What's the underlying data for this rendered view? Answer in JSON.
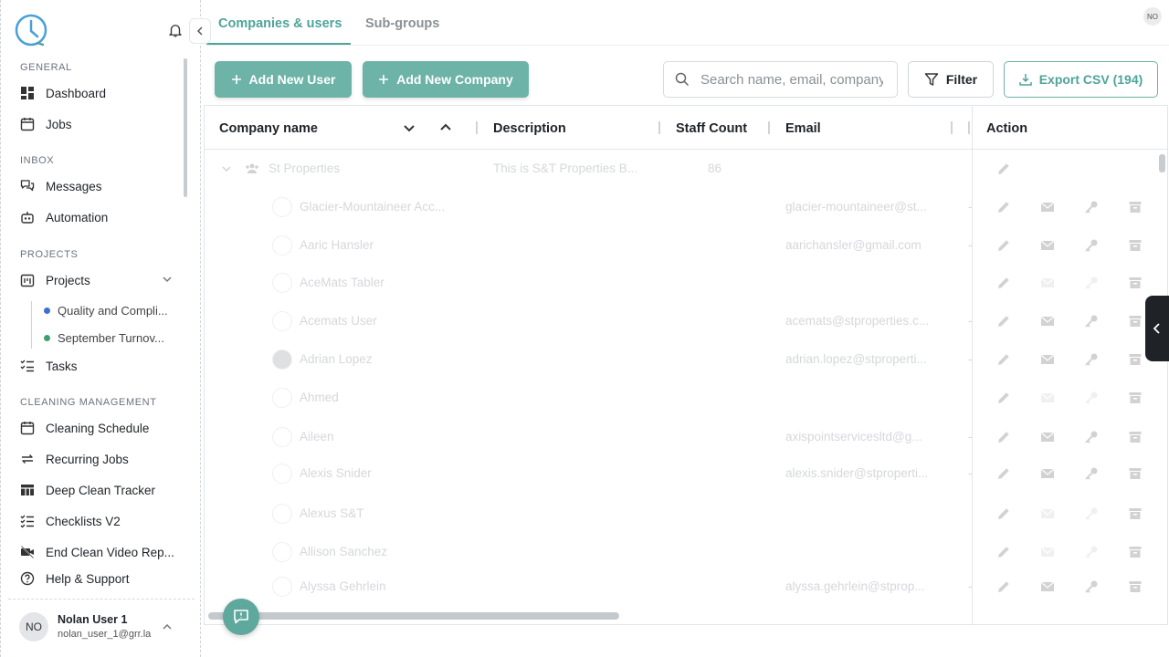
{
  "colors": {
    "accent": "#4ea49a",
    "button": "#6db3a8",
    "blue_dot": "#3b6fd4",
    "green_dot": "#3f9e6f"
  },
  "sidebar": {
    "sections": [
      {
        "label": "GENERAL"
      },
      {
        "label": "INBOX"
      },
      {
        "label": "PROJECTS"
      },
      {
        "label": "CLEANING MANAGEMENT"
      }
    ],
    "items": {
      "dashboard": "Dashboard",
      "jobs": "Jobs",
      "messages": "Messages",
      "automation": "Automation",
      "projects": "Projects",
      "quality": "Quality and Compli...",
      "september": "September Turnov...",
      "tasks": "Tasks",
      "cleaning_schedule": "Cleaning Schedule",
      "recurring_jobs": "Recurring Jobs",
      "deep_clean": "Deep Clean Tracker",
      "checklists": "Checklists V2",
      "end_clean": "End Clean Video Rep...",
      "help": "Help & Support"
    },
    "user": {
      "initials": "NO",
      "name": "Nolan User 1",
      "email": "nolan_user_1@grr.la"
    }
  },
  "tabs": [
    {
      "label": "Companies & users"
    },
    {
      "label": "Sub-groups"
    }
  ],
  "top_avatar": "NO",
  "toolbar": {
    "add_user": "Add New User",
    "add_company": "Add New Company",
    "search_placeholder": "Search name, email, company",
    "filter": "Filter",
    "export": "Export CSV (194)"
  },
  "table": {
    "columns": {
      "company": "Company name",
      "description": "Description",
      "staff": "Staff Count",
      "email": "Email",
      "action": "Action"
    },
    "group": {
      "name": "St Properties",
      "description": "This is S&T Properties B...",
      "staff": "86"
    },
    "rows": [
      {
        "name": "Glacier-Mountaineer Acc...",
        "email": "glacier-mountaineer@st..."
      },
      {
        "name": "Aaric Hansler",
        "email": "aarichansler@gmail.com"
      },
      {
        "name": "AceMats Tabler",
        "email": ""
      },
      {
        "name": "Acemats User",
        "email": "acemats@stproperties.c..."
      },
      {
        "name": "Adrian Lopez",
        "email": "adrian.lopez@stproperti..."
      },
      {
        "name": "Ahmed",
        "email": ""
      },
      {
        "name": "Aileen",
        "email": "axispointservicesltd@g..."
      },
      {
        "name": "Alexis Snider",
        "email": "alexis.snider@stproperti..."
      },
      {
        "name": "Alexus S&T",
        "email": ""
      },
      {
        "name": "Allison Sanchez",
        "email": ""
      },
      {
        "name": "Alyssa Gehrlein",
        "email": "alyssa.gehrlein@stprop..."
      }
    ]
  }
}
